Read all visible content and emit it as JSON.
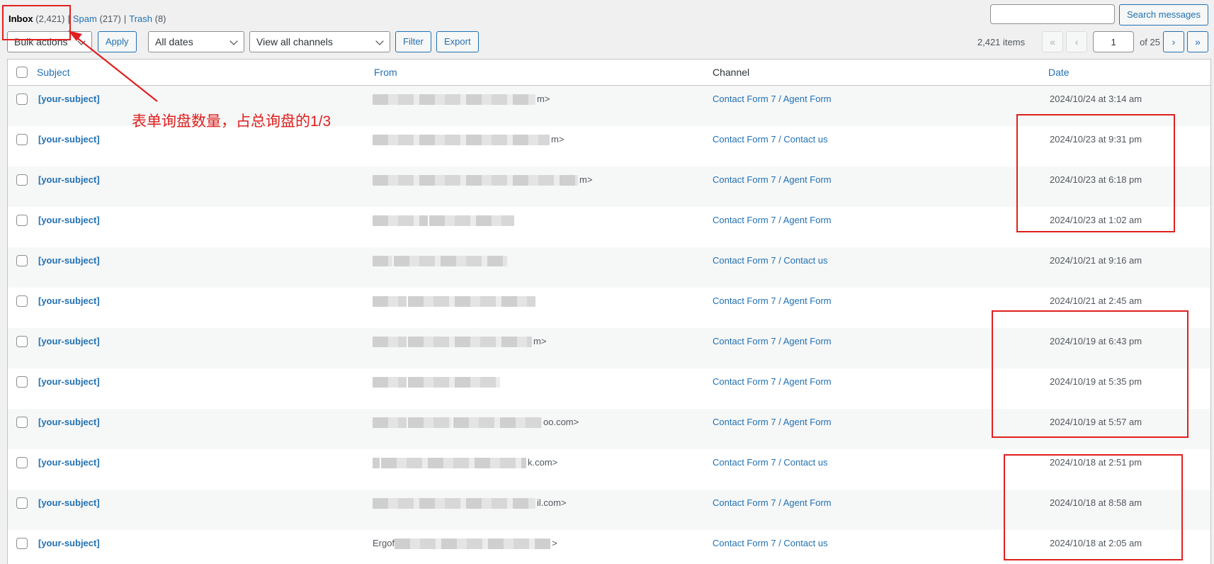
{
  "filters": {
    "inbox_label": "Inbox",
    "inbox_count": "(2,421)",
    "spam_label": "Spam",
    "spam_count": "(217)",
    "trash_label": "Trash",
    "trash_count": "(8)"
  },
  "search": {
    "value": "",
    "button_label": "Search messages"
  },
  "toolbar": {
    "bulk_actions": "Bulk actions",
    "apply_label": "Apply",
    "dates_select": "All dates",
    "channels_select": "View all channels",
    "filter_label": "Filter",
    "export_label": "Export"
  },
  "pagination": {
    "items_count": "2,421 items",
    "first": "«",
    "prev": "‹",
    "current_page": "1",
    "of_pages": "of 25",
    "next": "›",
    "last": "»"
  },
  "table": {
    "columns": {
      "subject": "Subject",
      "from": "From",
      "channel": "Channel",
      "date": "Date"
    },
    "rows": [
      {
        "subject": "[your-subject]",
        "from_prefix": "",
        "from_suffix": "m>",
        "channel": "Contact Form 7 / Agent Form",
        "date": "2024/10/24 at 3:14 am"
      },
      {
        "subject": "[your-subject]",
        "from_prefix": "",
        "from_suffix": "m>",
        "channel": "Contact Form 7 / Contact us",
        "date": "2024/10/23 at 9:31 pm"
      },
      {
        "subject": "[your-subject]",
        "from_prefix": "",
        "from_suffix": "m>",
        "channel": "Contact Form 7 / Agent Form",
        "date": "2024/10/23 at 6:18 pm"
      },
      {
        "subject": "[your-subject]",
        "from_prefix": "",
        "from_suffix": "",
        "channel": "Contact Form 7 / Agent Form",
        "date": "2024/10/23 at 1:02 am"
      },
      {
        "subject": "[your-subject]",
        "from_prefix": "",
        "from_suffix": "",
        "channel": "Contact Form 7 / Contact us",
        "date": "2024/10/21 at 9:16 am"
      },
      {
        "subject": "[your-subject]",
        "from_prefix": "",
        "from_suffix": "",
        "channel": "Contact Form 7 / Agent Form",
        "date": "2024/10/21 at 2:45 am"
      },
      {
        "subject": "[your-subject]",
        "from_prefix": "",
        "from_suffix": "m>",
        "channel": "Contact Form 7 / Agent Form",
        "date": "2024/10/19 at 6:43 pm"
      },
      {
        "subject": "[your-subject]",
        "from_prefix": "",
        "from_suffix": "",
        "channel": "Contact Form 7 / Agent Form",
        "date": "2024/10/19 at 5:35 pm"
      },
      {
        "subject": "[your-subject]",
        "from_prefix": "",
        "from_suffix": "oo.com>",
        "channel": "Contact Form 7 / Agent Form",
        "date": "2024/10/19 at 5:57 am"
      },
      {
        "subject": "[your-subject]",
        "from_prefix": "",
        "from_suffix": "k.com>",
        "channel": "Contact Form 7 / Contact us",
        "date": "2024/10/18 at 2:51 pm"
      },
      {
        "subject": "[your-subject]",
        "from_prefix": "",
        "from_suffix": "il.com>",
        "channel": "Contact Form 7 / Agent Form",
        "date": "2024/10/18 at 8:58 am"
      },
      {
        "subject": "[your-subject]",
        "from_prefix": "Ergof",
        "from_suffix": ">",
        "channel": "Contact Form 7 / Contact us",
        "date": "2024/10/18 at 2:05 am"
      }
    ]
  },
  "annotation": {
    "text": "表单询盘数量，占总询盘的1/3",
    "color": "#e02020"
  }
}
